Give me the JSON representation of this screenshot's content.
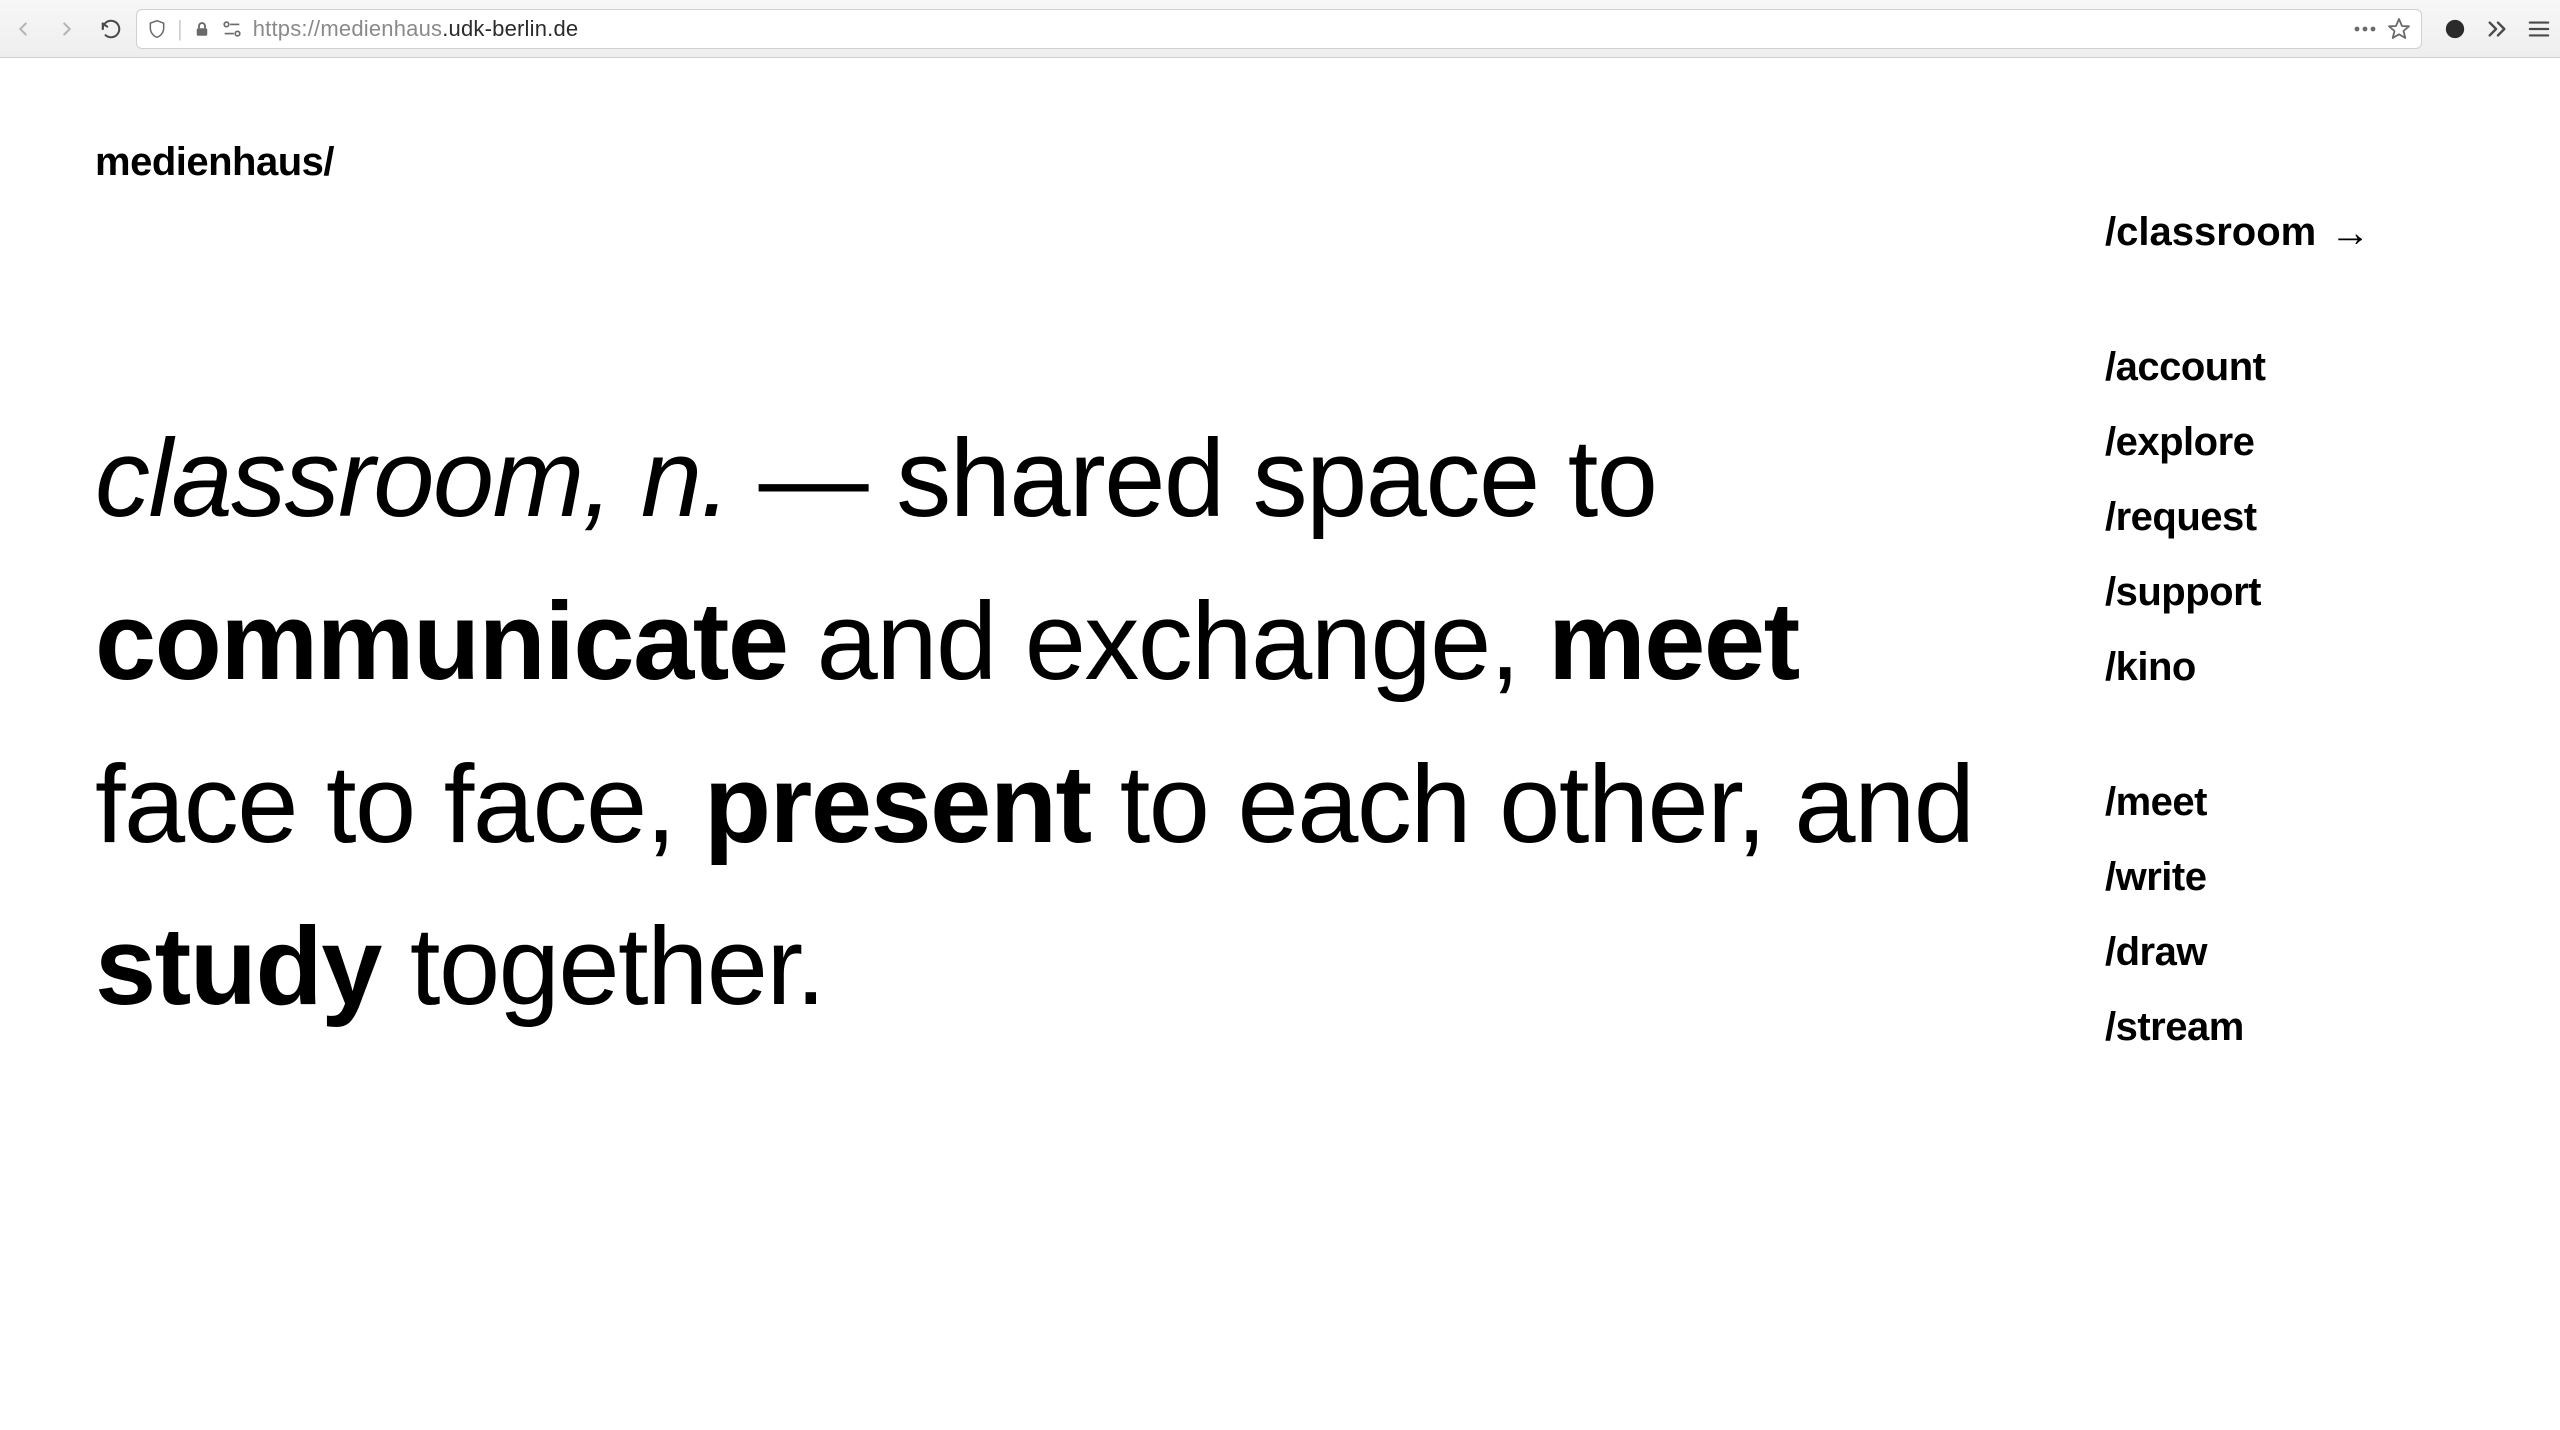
{
  "browser": {
    "url_scheme": "https://",
    "url_sub": "medienhaus",
    "url_dot": ".",
    "url_main": "udk-berlin.de"
  },
  "header": {
    "logo": "medienhaus/",
    "current": "/classroom",
    "arrow": "→"
  },
  "nav": {
    "group1": [
      "/account",
      "/explore",
      "/request",
      "/support",
      "/kino"
    ],
    "group2": [
      "/meet",
      "/write",
      "/draw",
      "/stream"
    ]
  },
  "definition": {
    "term": "classroom, n.",
    "sep": " — ",
    "t1": "shared space to ",
    "b1": "communicate",
    "t2": " and exchange, ",
    "b2": "meet",
    "t3": " face to face, ",
    "b3": "present",
    "t4": " to each other, and ",
    "b4": "study",
    "t5": " together."
  }
}
